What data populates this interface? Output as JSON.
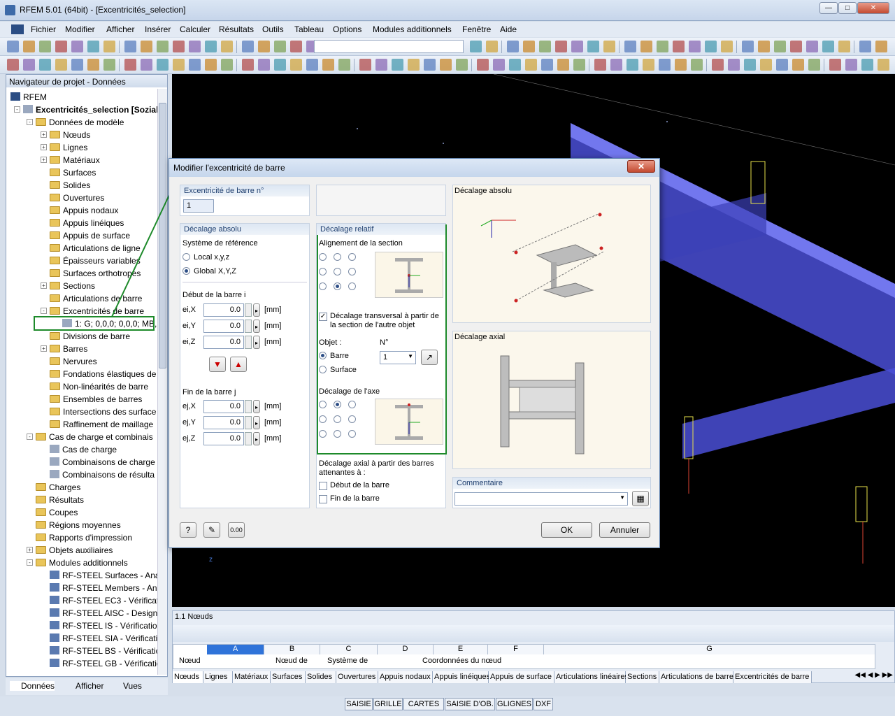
{
  "window": {
    "title": "RFEM 5.01 (64bit) - [Excentricités_selection]"
  },
  "menu": [
    "Fichier",
    "Modifier",
    "Afficher",
    "Insérer",
    "Calculer",
    "Résultats",
    "Outils",
    "Tableau",
    "Options",
    "Modules additionnels",
    "Fenêtre",
    "Aide"
  ],
  "navigator": {
    "title": "Navigateur de projet - Données",
    "root": "RFEM",
    "project": "Excentricités_selection [Sozial",
    "model": "Données de modèle",
    "model_items": [
      "Nœuds",
      "Lignes",
      "Matériaux",
      "Surfaces",
      "Solides",
      "Ouvertures",
      "Appuis nodaux",
      "Appuis linéiques",
      "Appuis de surface",
      "Articulations de ligne",
      "Épaisseurs variables",
      "Surfaces orthotropes",
      "Sections",
      "Articulations de barre",
      "Excentricités de barre"
    ],
    "selected_item": "1: G; 0,0,0; 0,0,0; MB,",
    "model_items2": [
      "Divisions de barre",
      "Barres",
      "Nervures",
      "Fondations élastiques de",
      "Non-linéarités de barre",
      "Ensembles de barres",
      "Intersections des surface",
      "Raffinement de maillage"
    ],
    "loads": "Cas de charge et combinais",
    "load_items": [
      "Cas de charge",
      "Combinaisons de charge",
      "Combinaisons de résulta"
    ],
    "top_items": [
      "Charges",
      "Résultats",
      "Coupes",
      "Régions moyennes",
      "Rapports d'impression",
      "Objets auxiliaires",
      "Modules additionnels"
    ],
    "modules": [
      "RF-STEEL Surfaces - Ana",
      "RF-STEEL Members - An",
      "RF-STEEL EC3 - Vérificat",
      "RF-STEEL AISC - Design",
      "RF-STEEL IS - Vérificatio",
      "RF-STEEL SIA - Vérificati",
      "RF-STEEL BS - Vérificatic",
      "RF-STEEL GB - Vérificatic"
    ],
    "tabs": [
      "Données",
      "Afficher",
      "Vues"
    ]
  },
  "dialog": {
    "title": "Modifier l'excentricité de barre",
    "ecc_no_label": "Excentricité de barre n°",
    "ecc_no_value": "1",
    "absolute_header": "Décalage absolu",
    "ref_system_label": "Système de référence",
    "ref_local": "Local x,y,z",
    "ref_global": "Global X,Y,Z",
    "start_label": "Début de la barre i",
    "end_label": "Fin de la barre j",
    "fields_i": [
      {
        "label": "ei,X",
        "value": "0.0",
        "unit": "[mm]"
      },
      {
        "label": "ei,Y",
        "value": "0.0",
        "unit": "[mm]"
      },
      {
        "label": "ei,Z",
        "value": "0.0",
        "unit": "[mm]"
      }
    ],
    "fields_j": [
      {
        "label": "ej,X",
        "value": "0.0",
        "unit": "[mm]"
      },
      {
        "label": "ej,Y",
        "value": "0.0",
        "unit": "[mm]"
      },
      {
        "label": "ej,Z",
        "value": "0.0",
        "unit": "[mm]"
      }
    ],
    "relative_header": "Décalage relatif",
    "section_align": "Alignement de la section",
    "transversal": "Décalage transversal à partir de la section de l'autre objet",
    "object_label": "Objet :",
    "no_label": "N°",
    "object_bar": "Barre",
    "object_surface": "Surface",
    "object_no": "1",
    "axis_offset": "Décalage de l'axe",
    "axial_from": "Décalage axial à partir des barres attenantes à :",
    "start_bar": "Début de la barre",
    "end_bar": "Fin de la barre",
    "pic_absolute": "Décalage absolu",
    "pic_axial": "Décalage axial",
    "comment_label": "Commentaire",
    "ok": "OK",
    "cancel": "Annuler"
  },
  "table": {
    "title": "1.1 Nœuds",
    "columns": [
      "A",
      "B",
      "C",
      "D",
      "E",
      "F",
      "G"
    ],
    "subheaders": [
      "Nœud",
      "Nœud de",
      "Système de",
      "Coordonnées du nœud"
    ],
    "tabs": [
      "Nœuds",
      "Lignes",
      "Matériaux",
      "Surfaces",
      "Solides",
      "Ouvertures",
      "Appuis nodaux",
      "Appuis linéiques",
      "Appuis de surface",
      "Articulations linéaires",
      "Sections",
      "Articulations de barre",
      "Excentricités de barre"
    ]
  },
  "statusbar": [
    "SAISIE",
    "GRILLE",
    "CARTES",
    "SAISIE D'OB.",
    "GLIGNES",
    "DXF"
  ],
  "viewport_axis": "z",
  "colors": {
    "accent_green": "#1d8a2a",
    "beam_blue": "#4a4fd6",
    "viewport_bg": "#000000"
  }
}
